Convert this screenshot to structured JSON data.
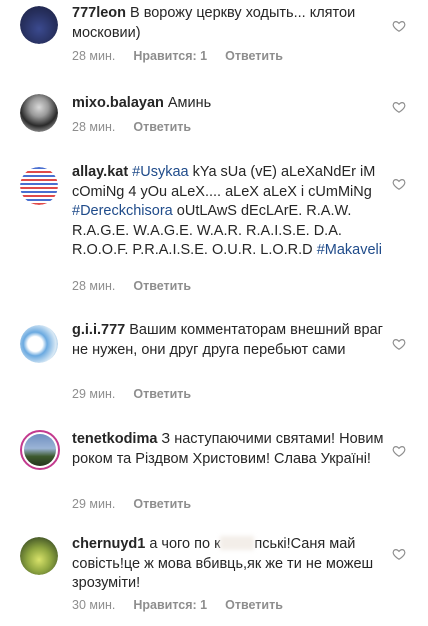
{
  "comments": [
    {
      "username": "777leon",
      "text": "В ворожу церкву ходыть... клятои московии)",
      "time": "28 мин.",
      "likes": "Нравится: 1",
      "reply": "Ответить"
    },
    {
      "username": "mixo.balayan",
      "text": "Аминь",
      "time": "28 мин.",
      "reply": "Ответить"
    },
    {
      "username": "allay.kat",
      "parts": [
        {
          "t": "#Usykaa",
          "tag": true
        },
        {
          "t": " kYa sUa (vE) aLeXaNdEr iM cOmiNg 4 yOu aLeX.... aLeX aLeX i cUmMiNg ",
          "tag": false
        },
        {
          "t": "#Dereckchisora",
          "tag": true
        },
        {
          "t": " oUtLAwS dEcLArE.  R.A.W. R.A.G.E. W.A.G.E. W.A.R. R.A.I.S.E. D.A. R.O.O.F. P.R.A.I.S.E. O.U.R. L.O.R.D ",
          "tag": false
        },
        {
          "t": "#Makaveli",
          "tag": true
        }
      ],
      "time": "28 мин.",
      "reply": "Ответить"
    },
    {
      "username": "g.i.i.777",
      "text": "Вашим комментаторам внешний враг не нужен, они друг друга перебьют сами",
      "time": "29 мин.",
      "reply": "Ответить"
    },
    {
      "username": "tenetkodima",
      "text": "З наступаючими святами! Новим роком та Різдвом Христовим! Слава Україні!",
      "time": "29 мин.",
      "reply": "Ответить"
    },
    {
      "username": "chernuyd1",
      "text_before": "а чого по к",
      "text_after": "пські!Саня  май совість!це ж мова вбивць,як  же ти не можеш зрозуміти!",
      "time": "30 мин.",
      "likes": "Нравится: 1",
      "reply": "Ответить"
    }
  ]
}
